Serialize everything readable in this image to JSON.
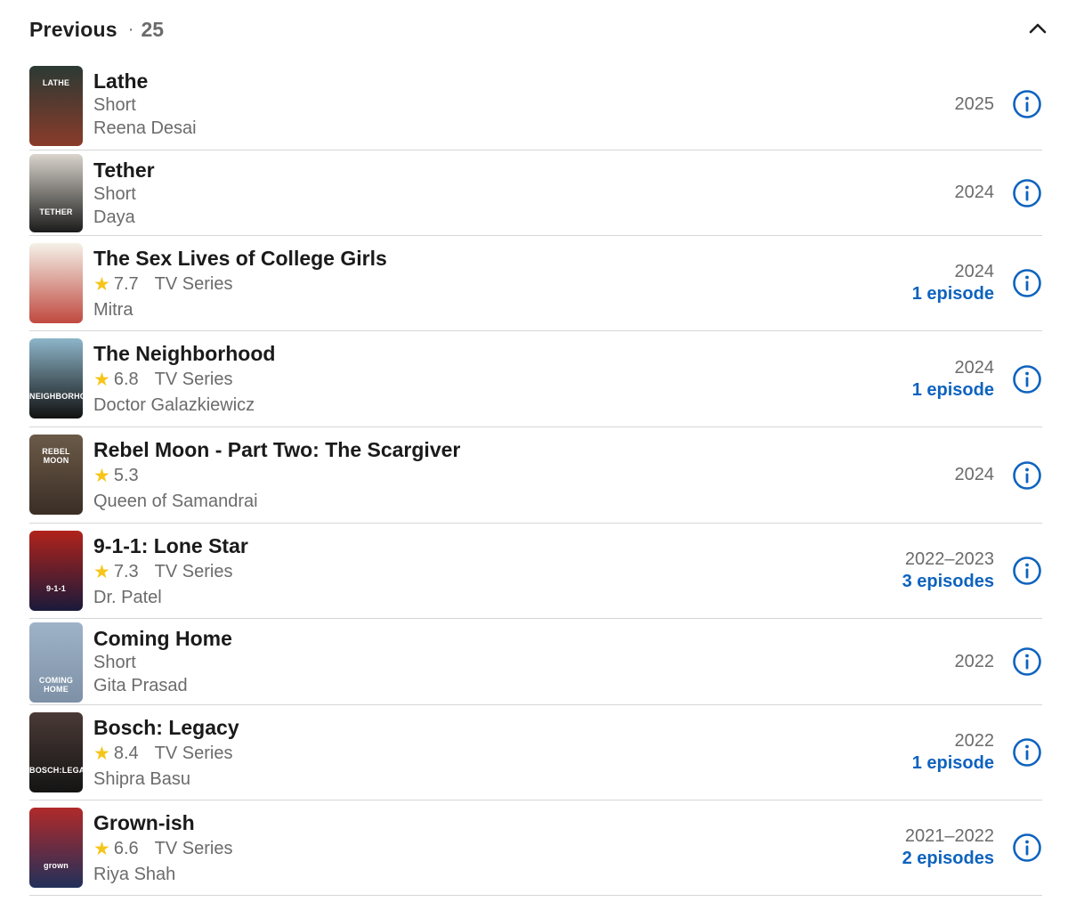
{
  "header": {
    "title": "Previous",
    "separator": "·",
    "count": "25"
  },
  "colors": {
    "accent": "#0e63be",
    "star": "#f5c518",
    "muted": "#6b6b6b"
  },
  "items": [
    {
      "title": "Lathe",
      "type": "Short",
      "rating": "",
      "role": "Reena Desai",
      "years": "2025",
      "episodes": "",
      "poster_text": "LATHE",
      "poster_colors": [
        "#2b3a34",
        "#8a3b2a"
      ]
    },
    {
      "title": "Tether",
      "type": "Short",
      "rating": "",
      "role": "Daya",
      "years": "2024",
      "episodes": "",
      "poster_text": "TETHER",
      "poster_colors": [
        "#d9d4cc",
        "#1b1b1b"
      ]
    },
    {
      "title": "The Sex Lives of College Girls",
      "type": "TV Series",
      "rating": "7.7",
      "role": "Mitra",
      "years": "2024",
      "episodes": "1 episode",
      "poster_text": "",
      "poster_colors": [
        "#f4f1e8",
        "#c0493f"
      ]
    },
    {
      "title": "The Neighborhood",
      "type": "TV Series",
      "rating": "6.8",
      "role": "Doctor Galazkiewicz",
      "years": "2024",
      "episodes": "1 episode",
      "poster_text": "NEIGHBORHOOD",
      "poster_colors": [
        "#8db5c9",
        "#111111"
      ]
    },
    {
      "title": "Rebel Moon - Part Two: The Scargiver",
      "type": "",
      "rating": "5.3",
      "role": "Queen of Samandrai",
      "years": "2024",
      "episodes": "",
      "poster_text": "REBEL MOON",
      "poster_colors": [
        "#6b5a48",
        "#3a2e25"
      ]
    },
    {
      "title": "9-1-1: Lone Star",
      "type": "TV Series",
      "rating": "7.3",
      "role": "Dr. Patel",
      "years": "2022–2023",
      "episodes": "3 episodes",
      "poster_text": "9-1-1",
      "poster_colors": [
        "#b0231b",
        "#1a1a3a"
      ]
    },
    {
      "title": "Coming Home",
      "type": "Short",
      "rating": "",
      "role": "Gita Prasad",
      "years": "2022",
      "episodes": "",
      "poster_text": "COMING HOME",
      "poster_colors": [
        "#9fb3c8",
        "#7d90a6"
      ]
    },
    {
      "title": "Bosch: Legacy",
      "type": "TV Series",
      "rating": "8.4",
      "role": "Shipra Basu",
      "years": "2022",
      "episodes": "1 episode",
      "poster_text": "BOSCH:LEGACY",
      "poster_colors": [
        "#4a3a36",
        "#141414"
      ]
    },
    {
      "title": "Grown-ish",
      "type": "TV Series",
      "rating": "6.6",
      "role": "Riya Shah",
      "years": "2021–2022",
      "episodes": "2 episodes",
      "poster_text": "grown",
      "poster_colors": [
        "#b02a2a",
        "#22305a"
      ]
    }
  ]
}
